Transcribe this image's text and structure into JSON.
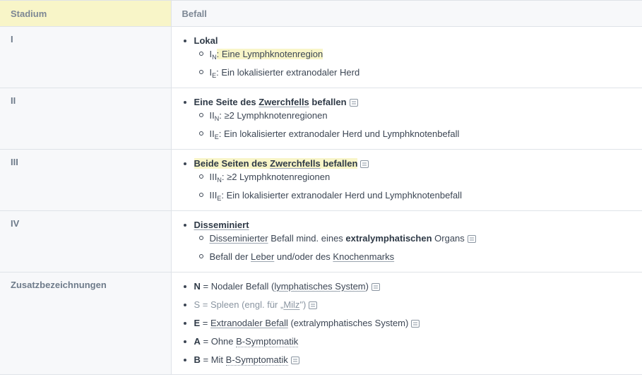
{
  "header": {
    "stadium": "Stadium",
    "befall": "Befall"
  },
  "rows": [
    {
      "stage": "I",
      "main": "Lokal",
      "sub": [
        {
          "prefix": "I",
          "subscript": "N",
          "text": ": Eine Lymphknotenregion"
        },
        {
          "prefix": "I",
          "subscript": "E",
          "text": ": Ein lokalisierter extranodaler Herd"
        }
      ]
    },
    {
      "stage": "II",
      "main_a": "Eine Seite des ",
      "main_b": "Zwerchfells",
      "main_c": " befallen",
      "sub": [
        {
          "prefix": "II",
          "subscript": "N",
          "text": ": ≥2 Lymphknotenregionen"
        },
        {
          "prefix": "II",
          "subscript": "E",
          "text": ": Ein lokalisierter extranodaler Herd und Lymphknotenbefall"
        }
      ]
    },
    {
      "stage": "III",
      "main_a": "Beide Seiten des ",
      "main_b": "Zwerchfells",
      "main_c": " befallen",
      "sub": [
        {
          "prefix": "III",
          "subscript": "N",
          "text": ": ≥2 Lymphknotenregionen"
        },
        {
          "prefix": "III",
          "subscript": "E",
          "text": ": Ein lokalisierter extranodaler Herd und Lymphknotenbefall"
        }
      ]
    },
    {
      "stage": "IV",
      "main": "Disseminiert",
      "sub1": {
        "a": "Disseminierter",
        "b": " Befall mind. eines ",
        "c": "extralymphatischen",
        "d": " Organs"
      },
      "sub2": {
        "a": "Befall der ",
        "b": "Leber",
        "c": " und/oder des ",
        "d": "Knochenmarks"
      }
    },
    {
      "stage": "Zusatzbezeichnungen",
      "items": [
        {
          "key": "N",
          "a": " = Nodaler Befall (",
          "b": "lymphatisches System",
          "c": ")"
        },
        {
          "key": "S",
          "a": " = Spleen (engl. für „",
          "b": "Milz",
          "c": "\")"
        },
        {
          "key": "E",
          "a": " = ",
          "b": "Extranodaler Befall",
          "c": " (extralymphatisches System)"
        },
        {
          "key": "A",
          "a": " = Ohne ",
          "b": "B-Symptomatik",
          "c": ""
        },
        {
          "key": "B",
          "a": " = Mit ",
          "b": "B-Symptomatik",
          "c": ""
        }
      ]
    }
  ]
}
